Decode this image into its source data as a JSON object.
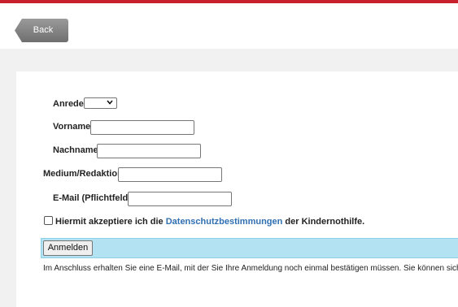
{
  "header": {
    "back_label": "Back"
  },
  "form": {
    "anrede_label": "Anrede",
    "anrede_value": "",
    "vorname_label": "Vorname",
    "vorname_value": "",
    "nachname_label": "Nachname",
    "nachname_value": "",
    "medium_label": "Medium/Redaktion",
    "medium_value": "",
    "email_label": "E-Mail (Pflichtfeld)",
    "email_value": "",
    "consent_checked": false,
    "consent_prefix": "Hiermit akzeptiere ich die ",
    "consent_link": "Datenschutzbestimmungen",
    "consent_suffix": " der Kindernothilfe.",
    "submit_label": "Anmelden",
    "note": "Im Anschluss erhalten Sie eine E-Mail, mit der Sie Ihre Anmeldung noch einmal bestätigen müssen. Sie können sich"
  },
  "colors": {
    "accent": "#c6212d",
    "link": "#2f6fb2",
    "submit_bar": "#b3e2f2"
  }
}
